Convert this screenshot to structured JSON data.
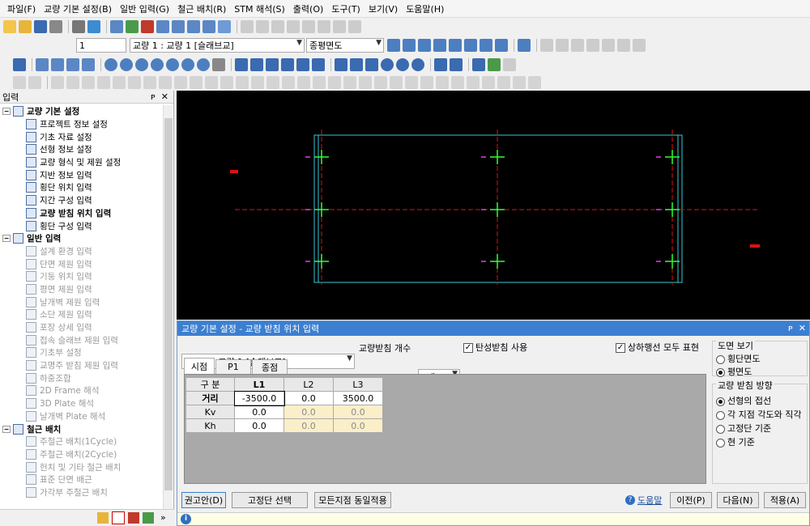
{
  "menu": [
    "파일(F)",
    "교량 기본 설정(B)",
    "일반 입력(G)",
    "철근 배치(R)",
    "STM 해석(S)",
    "출력(O)",
    "도구(T)",
    "보기(V)",
    "도움말(H)"
  ],
  "toolbar": {
    "bridge_number": "1",
    "bridge_select": "교량 1 : 교량 1 [슬래브교]",
    "view_select": "종평면도"
  },
  "left_panel": {
    "title": "입력",
    "pin": "ᴘ",
    "close": "✕",
    "groups": [
      {
        "label": "교량 기본 설정",
        "items": [
          "프로젝트 정보 설정",
          "기초 자료 설정",
          "선형 정보 설정",
          "교량 형식 및 제원 설정",
          "지반 정보 입력",
          "횡단 위치 입력",
          "지간 구성 입력",
          "교량 받침 위치 입력",
          "횡단 구성 입력"
        ]
      },
      {
        "label": "일반 입력",
        "items": [
          "설계 환경 입력",
          "단면 제원 입력",
          "기둥 위치 입력",
          "평면 제원 입력",
          "날개벽 제원 입력",
          "소단 제원 입력",
          "포장 상세 입력",
          "접속 슬래브 제원 입력",
          "기초부 설정",
          "교명주 받침 제원 입력",
          "하중조합",
          "2D Frame 해석",
          "3D Plate 해석",
          "날개벽 Plate 해석"
        ]
      },
      {
        "label": "철근 배치",
        "items": [
          "주철근 배치(1Cycle)",
          "주철근 배치(2Cycle)",
          "헌치 및 기타 철근 배치",
          "표준 단면 배근",
          "가각부 주철근 배치"
        ]
      }
    ]
  },
  "dialog": {
    "title": "교량 기본 설정 - 교량 받침 위치 입력",
    "pin": "ᴘ",
    "close": "✕",
    "bridge_select": "교량 1 : 교량 1 [슬래브교]",
    "bearing_count_label": "교량받침 개수",
    "bearing_count_value": "3개",
    "elastic_bearing_label": "탄성받침 사용",
    "show_all_lines_label": "상하행선 모두 표현",
    "tabs": [
      "시점",
      "P1",
      "종점"
    ],
    "table": {
      "corner": "구 분",
      "columns": [
        "L1",
        "L2",
        "L3"
      ],
      "rows": [
        {
          "label": "거리",
          "values": [
            "-3500.0",
            "0.0",
            "3500.0"
          ]
        },
        {
          "label": "Kv",
          "values": [
            "0.0",
            "0.0",
            "0.0"
          ]
        },
        {
          "label": "Kh",
          "values": [
            "0.0",
            "0.0",
            "0.0"
          ]
        }
      ]
    },
    "view_group_title": "도면 보기",
    "view_options": [
      "횡단면도",
      "평면도"
    ],
    "view_selected": 1,
    "direction_group_title": "교량 받침 방향",
    "direction_options": [
      "선형의 접선",
      "각 지점 각도와 직각",
      "고정단 기준",
      "현 기준"
    ],
    "direction_selected": 0,
    "buttons": {
      "recommend": "권고안(D)",
      "fixed_select": "고정단 선택",
      "apply_all": "모든지점 동일적용",
      "help": "도움말",
      "prev": "이전(P)",
      "next": "다음(N)",
      "apply": "적용(A)"
    }
  },
  "status": {
    "info_icon": "i"
  },
  "colors": {
    "canvas_bg": "#000000",
    "dialog_title": "#3c7fd0",
    "cyan": "#38c8d8",
    "red": "#e01010",
    "green": "#30ff30",
    "magenta": "#e040e0"
  }
}
